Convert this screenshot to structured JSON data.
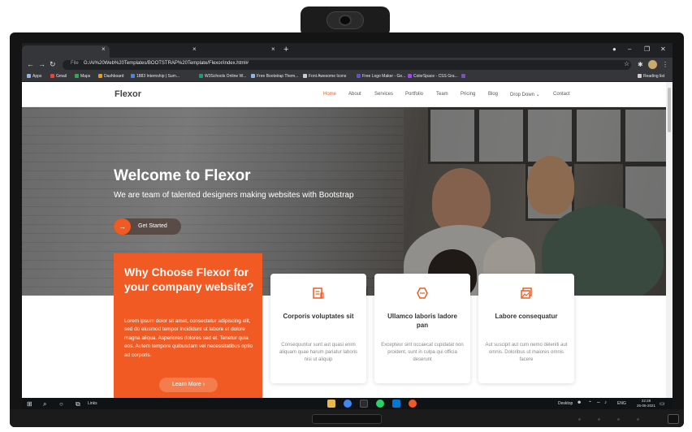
{
  "colors": {
    "accent": "#f15a22",
    "browser_dark": "#35363a",
    "taskbar": "#101316"
  },
  "browser": {
    "tabs": [
      {
        "label": ""
      },
      {
        "label": ""
      }
    ],
    "tab_close": "×",
    "new_tab": "+",
    "address": {
      "scheme_label": "File",
      "url": "G:/AI%20Web%20Templates/BOOTSTRAP%20Template/Flexor/index.html#"
    },
    "bookmarks": [
      "Apps",
      "Gmail",
      "Maps",
      "Dashboard",
      "1883 Internship | Sum...",
      "W3Schools Online W...",
      "Free Bootstrap Them...",
      "Font Awesome Icons",
      "Free Logo Maker - Ge...",
      "ColorSpace - CSS Gra..."
    ],
    "reading_list": "Reading list"
  },
  "site": {
    "logo": "Flexor",
    "nav": [
      "Home",
      "About",
      "Services",
      "Portfolio",
      "Team",
      "Pricing",
      "Blog",
      "Drop Down",
      "Contact"
    ],
    "hero": {
      "title": "Welcome to Flexor",
      "subtitle": "We are team of talented designers making websites with Bootstrap",
      "cta_label": "Get Started",
      "cta_arrow": "→"
    },
    "why": {
      "title": "Why Choose Flexor for your company website?",
      "text": "Lorem ipsum dolor sit amet, consectetur adipiscing elit, sed do eiusmod tempor incididunt ut labore et dolore magna aliqua. Asperiores dolores sed et. Tenetur quia eos. Autem tempore quibusdam vel necessitatibus optio ad corporis.",
      "button": "Learn More ›"
    },
    "cards": [
      {
        "icon": "receipt-icon",
        "title": "Corporis voluptates sit",
        "text": "Consequuntur sunt aut quasi enim aliquam quae harum pariatur laboris nisi ut aliquip"
      },
      {
        "icon": "cube-alt-icon",
        "title": "Ullamco laboris ladore pan",
        "text": "Excepteur sint occaecat cupidatat non proident, sunt in culpa qui officia deserunt"
      },
      {
        "icon": "images-icon",
        "title": "Labore consequatur",
        "text": "Aut suscipit aut cum nemo deleniti aut omnis. Doloribus ut maiores omnis facere"
      }
    ]
  },
  "taskbar": {
    "links_label": "Links",
    "desktop_label": "Desktop",
    "lang": "ENG",
    "time": "22:28",
    "date": "26-06-2021"
  }
}
